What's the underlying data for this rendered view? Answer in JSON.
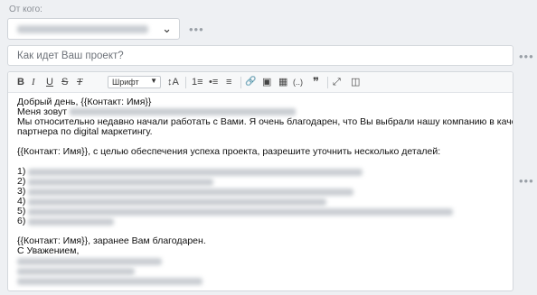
{
  "from": {
    "label": "От кого:",
    "chevron": "⌄"
  },
  "subject": {
    "placeholder": "Как идет Ваш проект?"
  },
  "toolbar": {
    "bold": "B",
    "italic": "I",
    "underline": "U",
    "strike": "S",
    "clear": "T",
    "font_label": "Шрифт",
    "font_size": "↕A",
    "ordered_list": "1≡",
    "bullet_list": "•≡",
    "align": "≡",
    "link": "🔗",
    "image": "▣",
    "table": "▦",
    "code": "(..)",
    "quote": "❞",
    "fullscreen": "⤢",
    "source": "◫"
  },
  "more_dots": "•••",
  "body": {
    "greeting": "Добрый день, {{Контакт: Имя}}",
    "my_name_prefix": "Меня зовут",
    "intro_1": "Мы относительно недавно начали работать с Вами. Я очень благодарен, что Вы выбрали нашу компанию в качестве",
    "intro_2": "партнера по digital маркетингу.",
    "details": "{{Контакт: Имя}}, с целью обеспечения успеха проекта, разрешите уточнить несколько деталей:",
    "list_numbers": [
      "1)",
      "2)",
      "3)",
      "4)",
      "5)",
      "6)"
    ],
    "thanks": "{{Контакт: Имя}}, заранее Вам благодарен.",
    "regards": "С Уважением,"
  }
}
